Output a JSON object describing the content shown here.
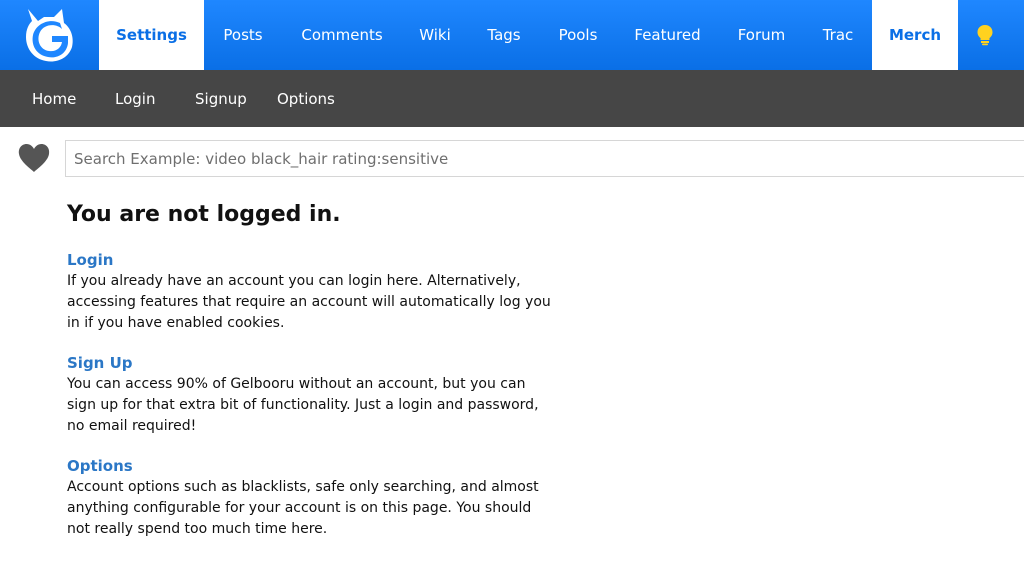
{
  "topnav": {
    "logo_icon": "gelbooru-logo-icon",
    "items": [
      {
        "label": "Settings",
        "active": true
      },
      {
        "label": "Posts",
        "active": false
      },
      {
        "label": "Comments",
        "active": false
      },
      {
        "label": "Wiki",
        "active": false
      },
      {
        "label": "Tags",
        "active": false
      },
      {
        "label": "Pools",
        "active": false
      },
      {
        "label": "Featured",
        "active": false
      },
      {
        "label": "Forum",
        "active": false
      },
      {
        "label": "Trac",
        "active": false
      },
      {
        "label": "Merch",
        "active": true
      }
    ],
    "theme_icon": "lightbulb-icon",
    "colors": {
      "bar": "#1f87ff",
      "active_text": "#0a6fe6",
      "bulb": "#ffd21f"
    }
  },
  "subnav": {
    "items": [
      {
        "label": "Home"
      },
      {
        "label": "Login"
      },
      {
        "label": "Signup"
      },
      {
        "label": "Options"
      }
    ],
    "color": "#464646"
  },
  "search": {
    "favorites_icon": "heart-icon",
    "placeholder": "Search Example: video black_hair rating:sensitive",
    "value": ""
  },
  "main": {
    "title": "You are not logged in.",
    "sections": [
      {
        "link": "Login",
        "text": "If you already have an account you can login here. Alternatively, accessing features that require an account will automatically log you in if you have enabled cookies."
      },
      {
        "link": "Sign Up",
        "text": "You can access 90% of Gelbooru without an account, but you can sign up for that extra bit of functionality. Just a login and password, no email required!"
      },
      {
        "link": "Options",
        "text": "Account options such as blacklists, safe only searching, and almost anything configurable for your account is on this page. You should not really spend too much time here."
      }
    ],
    "link_color": "#2b77c6"
  }
}
